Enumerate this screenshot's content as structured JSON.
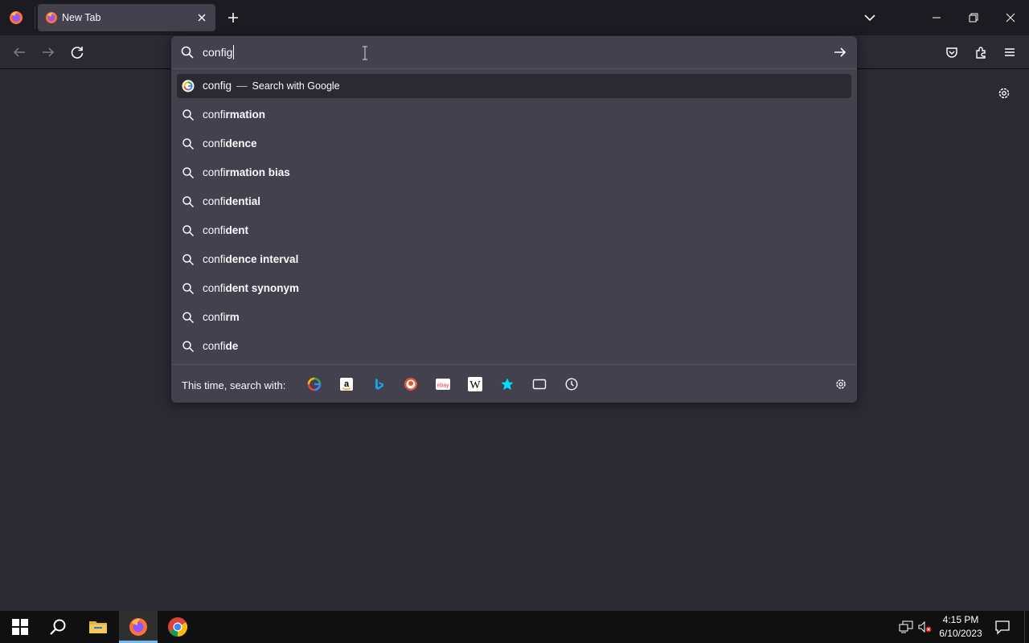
{
  "browser": {
    "tab": {
      "title": "New Tab"
    },
    "urlbar": {
      "value": "config"
    }
  },
  "suggestions": [
    {
      "typed": "config",
      "rest": "",
      "dash": "—",
      "action": "Search with Google",
      "type": "engine",
      "selected": true
    },
    {
      "typed": "confi",
      "rest": "rmation",
      "type": "search"
    },
    {
      "typed": "confi",
      "rest": "dence",
      "type": "search"
    },
    {
      "typed": "confi",
      "rest": "rmation bias",
      "type": "search"
    },
    {
      "typed": "confi",
      "rest": "dential",
      "type": "search"
    },
    {
      "typed": "confi",
      "rest": "dent",
      "type": "search"
    },
    {
      "typed": "confi",
      "rest": "dence interval",
      "type": "search"
    },
    {
      "typed": "confi",
      "rest": "dent synonym",
      "type": "search"
    },
    {
      "typed": "confi",
      "rest": "rm",
      "type": "search"
    },
    {
      "typed": "confi",
      "rest": "de",
      "type": "search"
    }
  ],
  "one_off": {
    "label": "This time, search with:",
    "engines": [
      "google",
      "amazon",
      "bing",
      "duckduckgo",
      "ebay",
      "wikipedia",
      "bookmarks",
      "tabs",
      "history"
    ]
  },
  "taskbar": {
    "time": "4:15 PM",
    "date": "6/10/2023"
  },
  "colors": {
    "tab_strip": "#1c1b22",
    "toolbar": "#2b2a33",
    "panel": "#42414d",
    "selected_row": "#2b2a33",
    "taskbar": "#101010",
    "accent": "#76b9ed"
  }
}
